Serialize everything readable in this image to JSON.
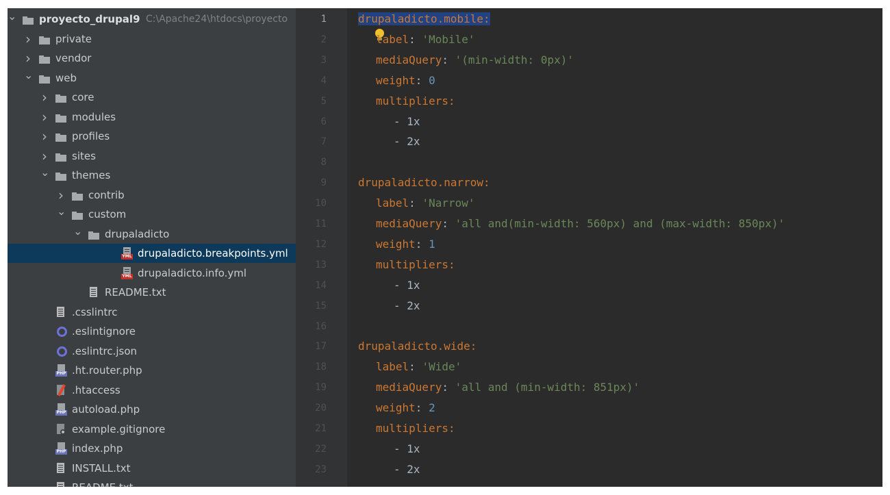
{
  "project": {
    "name": "proyecto_drupal9",
    "path": "C:\\Apache24\\htdocs\\proyecto"
  },
  "tree": [
    {
      "label": "private"
    },
    {
      "label": "vendor"
    },
    {
      "label": "web"
    },
    {
      "label": "core"
    },
    {
      "label": "modules"
    },
    {
      "label": "profiles"
    },
    {
      "label": "sites"
    },
    {
      "label": "themes"
    },
    {
      "label": "contrib"
    },
    {
      "label": "custom"
    },
    {
      "label": "drupaladicto"
    },
    {
      "label": "drupaladicto.breakpoints.yml",
      "selected": true
    },
    {
      "label": "drupaladicto.info.yml"
    },
    {
      "label": "README.txt"
    },
    {
      "label": ".csslintrc"
    },
    {
      "label": ".eslintignore"
    },
    {
      "label": ".eslintrc.json"
    },
    {
      "label": ".ht.router.php"
    },
    {
      "label": ".htaccess"
    },
    {
      "label": "autoload.php"
    },
    {
      "label": "example.gitignore"
    },
    {
      "label": "index.php"
    },
    {
      "label": "INSTALL.txt"
    },
    {
      "label": "README.txt"
    }
  ],
  "file_badges": {
    "yml": "YML",
    "php": "PHP"
  },
  "editor": {
    "active_line": 1,
    "line_numbers": [
      "1",
      "2",
      "3",
      "4",
      "5",
      "6",
      "7",
      "8",
      "9",
      "10",
      "11",
      "12",
      "13",
      "14",
      "15",
      "16",
      "17",
      "18",
      "19",
      "20",
      "21",
      "22",
      "23"
    ],
    "lines": [
      {
        "k": "drupaladicto.mobile:"
      },
      {
        "k": "label",
        "s": "'Mobile'"
      },
      {
        "k": "mediaQuery",
        "s": "'(min-width: 0px)'"
      },
      {
        "k": "weight",
        "n": "0"
      },
      {
        "k": "multipliers:"
      },
      {
        "p": "- 1x"
      },
      {
        "p": "- 2x"
      },
      {},
      {
        "k": "drupaladicto.narrow:"
      },
      {
        "k": "label",
        "s": "'Narrow'"
      },
      {
        "k": "mediaQuery",
        "s": "'all and(min-width: 560px) and (max-width: 850px)'"
      },
      {
        "k": "weight",
        "n": "1"
      },
      {
        "k": "multipliers:"
      },
      {
        "p": "- 1x"
      },
      {
        "p": "- 2x"
      },
      {},
      {
        "k": "drupaladicto.wide:"
      },
      {
        "k": "label",
        "s": "'Wide'"
      },
      {
        "k": "mediaQuery",
        "s": "'all and (min-width: 851px)'"
      },
      {
        "k": "weight",
        "n": "2"
      },
      {
        "k": "multipliers:"
      },
      {
        "p": "- 1x"
      },
      {
        "p": "- 2x"
      }
    ]
  },
  "colors": {
    "key": "#cc7832",
    "string": "#6a8759",
    "number": "#6897bb",
    "selection": "#214283",
    "tree_selection": "#0d3a5a"
  }
}
